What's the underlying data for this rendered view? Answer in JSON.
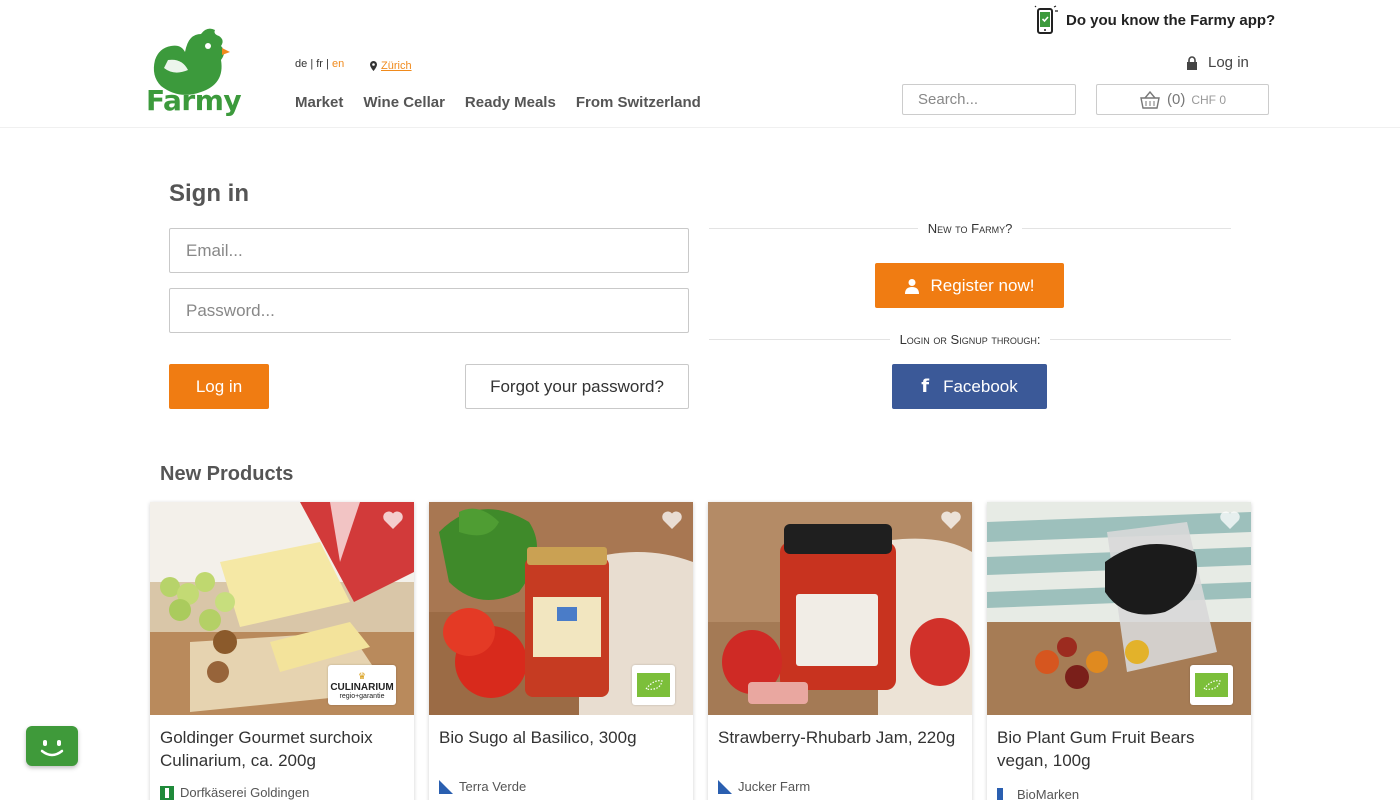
{
  "brand": {
    "name": "Farmy",
    "color": "#3c9a3c",
    "accent": "#f07c12"
  },
  "header": {
    "languages": [
      {
        "code": "de",
        "active": false
      },
      {
        "code": "fr",
        "active": false
      },
      {
        "code": "en",
        "active": true
      }
    ],
    "lang_sep": "|",
    "location": "Zürich",
    "nav": [
      "Market",
      "Wine Cellar",
      "Ready Meals",
      "From Switzerland"
    ],
    "app_promo": "Do you know the Farmy app?",
    "login_label": "Log in",
    "search_placeholder": "Search...",
    "cart": {
      "count": "(0)",
      "total": "CHF 0"
    }
  },
  "signin": {
    "title": "Sign in",
    "email_placeholder": "Email...",
    "password_placeholder": "Password...",
    "login_button": "Log in",
    "forgot_button": "Forgot your password?",
    "new_to": "New to Farmy?",
    "register_button": "Register now!",
    "login_through": "Login or Signup through:",
    "facebook_button": "Facebook"
  },
  "new_products": {
    "title": "New Products",
    "items": [
      {
        "title": "Goldinger Gourmet surchoix Culinarium, ca. 200g",
        "producer": "Dorfkäserei Goldingen",
        "badge": "culinarium",
        "badge_text": "CULINARIUM",
        "badge_sub": "regio+garantie"
      },
      {
        "title": "Bio Sugo al Basilico, 300g",
        "producer": "Terra Verde",
        "badge": "bio"
      },
      {
        "title": "Strawberry-Rhubarb Jam, 220g",
        "producer": "Jucker Farm",
        "badge": "none"
      },
      {
        "title": "Bio Plant Gum Fruit Bears vegan, 100g",
        "producer": "BioMarken",
        "badge": "bio"
      }
    ]
  },
  "colors": {
    "facebook": "#3b5998",
    "bio": "#7cbf3a"
  }
}
